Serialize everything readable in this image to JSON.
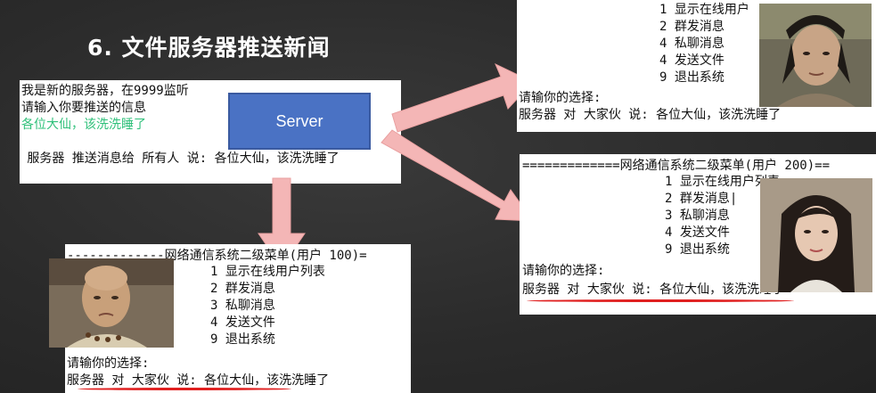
{
  "slide": {
    "title": "6. 文件服务器推送新闻"
  },
  "server_console": {
    "line1": "我是新的服务器，在9999监听",
    "line2": "请输入你要推送的信息",
    "line3": "各位大仙，该洗洗睡了",
    "line4": " 服务器 推送消息给 所有人 说: 各位大仙，该洗洗睡了"
  },
  "server_box": {
    "label": "Server"
  },
  "client_top": {
    "menu": [
      "1 显示在线用户",
      "2 群发消息",
      "4 私聊消息",
      "4 发送文件",
      "9 退出系统"
    ],
    "prompt": "请输你的选择:",
    "received": "服务器 对 大家伙 说: 各位大仙，该洗洗睡了"
  },
  "client_200": {
    "header": "=============网络通信系统二级菜单(用户 200)==",
    "menu": [
      "1 显示在线用户列表",
      "2 群发消息|",
      "3 私聊消息",
      "4 发送文件",
      "9 退出系统"
    ],
    "prompt": "请输你的选择:",
    "received": "服务器 对 大家伙 说: 各位大仙，该洗洗睡了"
  },
  "client_100": {
    "header": "-------------网络通信系统二级菜单(用户 100)=",
    "menu": [
      "1 显示在线用户列表",
      "2 群发消息",
      "3 私聊消息",
      "4 发送文件",
      "9 退出系统"
    ],
    "prompt": "请输你的选择:",
    "received": "服务器 对 大家伙 说: 各位大仙，该洗洗睡了"
  },
  "colors": {
    "arrow": "#f4b6b6",
    "server_fill": "#4a72c4",
    "underline": "#e02020",
    "green_text": "#2fc07a"
  }
}
